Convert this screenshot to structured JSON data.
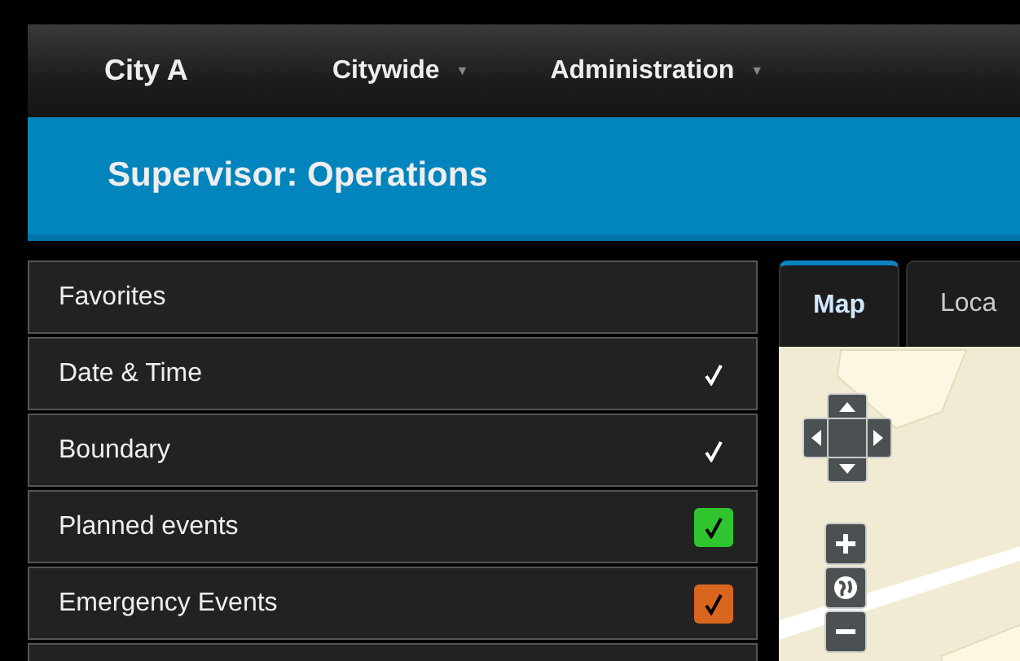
{
  "nav": {
    "brand": "City A",
    "menus": [
      {
        "label": "Citywide",
        "caret": "▼"
      },
      {
        "label": "Administration",
        "caret": "▼"
      }
    ]
  },
  "banner": {
    "title": "Supervisor: Operations"
  },
  "layers": [
    {
      "label": "Favorites",
      "checked": false
    },
    {
      "label": "Date & Time",
      "checked": true,
      "kind": "plain"
    },
    {
      "label": "Boundary",
      "checked": true,
      "kind": "plain"
    },
    {
      "label": "Planned events",
      "checked": true,
      "kind": "box",
      "color": "#2ec52e"
    },
    {
      "label": "Emergency Events",
      "checked": true,
      "kind": "box",
      "color": "#d9661f"
    }
  ],
  "tabs": [
    {
      "label": "Map",
      "selected": true
    },
    {
      "label": "Loca",
      "selected": false
    }
  ]
}
